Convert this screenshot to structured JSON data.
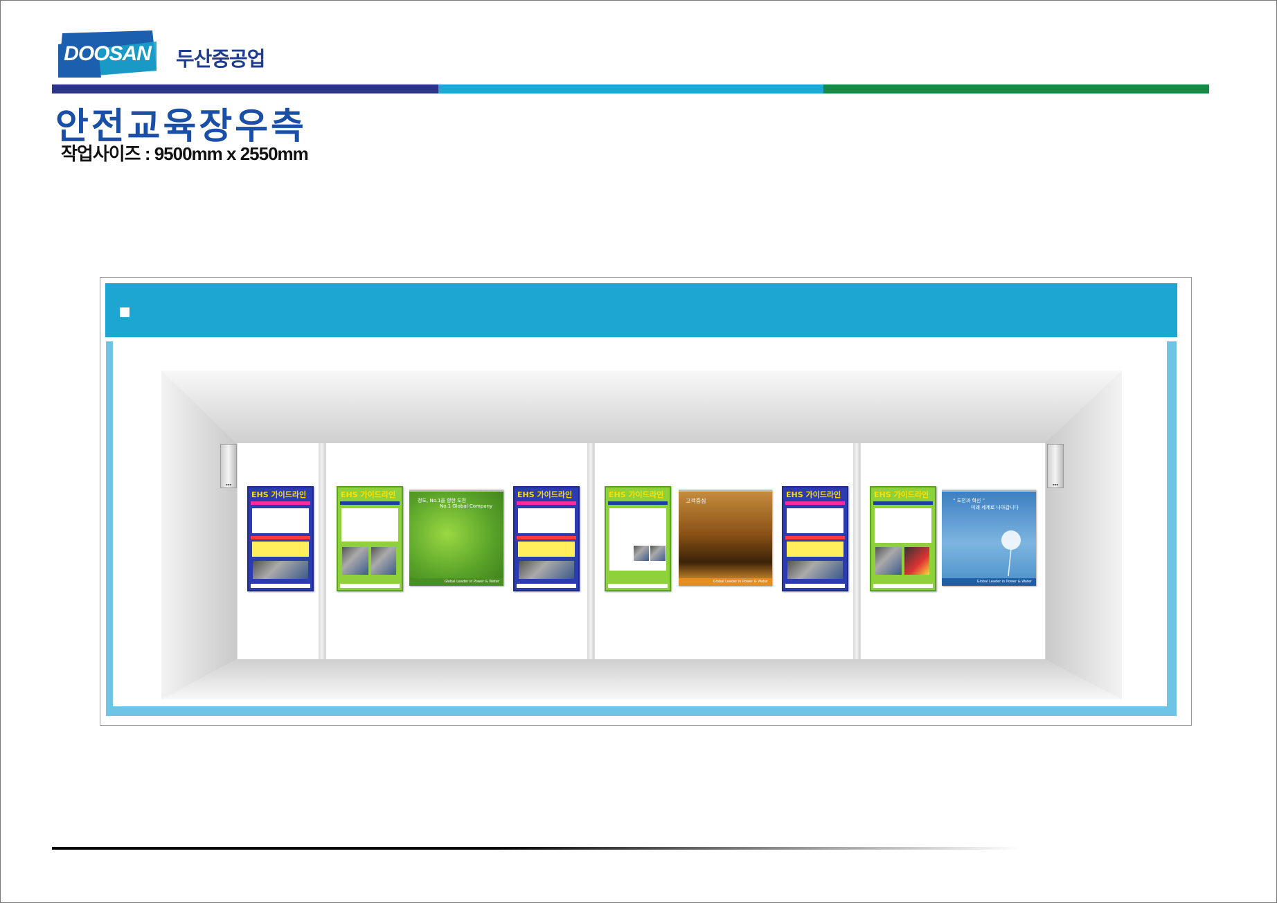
{
  "header": {
    "logo_text": "DOOSAN",
    "company_name": "두산중공업",
    "brand_colors": [
      "#2a3489",
      "#1ea7d4",
      "#148a45"
    ]
  },
  "title": "안전교육장우측",
  "subtitle": "작업사이즈 : 9500mm x 2550mm",
  "posters": [
    {
      "kind": "ehs-blue",
      "title": "EHS 가이드라인"
    },
    {
      "kind": "ehs-green",
      "title": "EHS 가이드라인"
    },
    {
      "kind": "leaf",
      "line1": "정도, No.1을 향한 도전",
      "line2": "No.1 Global Company",
      "footer": "Global Leader in Power & Water"
    },
    {
      "kind": "ehs-blue",
      "title": "EHS 가이드라인"
    },
    {
      "kind": "ehs-green",
      "title": "EHS 가이드라인"
    },
    {
      "kind": "palace",
      "line1": "고객중심",
      "footer": "Global Leader in Power & Water"
    },
    {
      "kind": "ehs-blue",
      "title": "EHS 가이드라인"
    },
    {
      "kind": "ehs-green",
      "title": "EHS 가이드라인"
    },
    {
      "kind": "sky",
      "line1": "“ 도전과 혁신 ”",
      "line2": "미래 세계로 나아갑니다",
      "footer": "Global Leader in Power & Water"
    }
  ],
  "colors": {
    "band": "#1ea6d2",
    "frame_side": "#6ec4e4",
    "title": "#1a4fa8"
  }
}
